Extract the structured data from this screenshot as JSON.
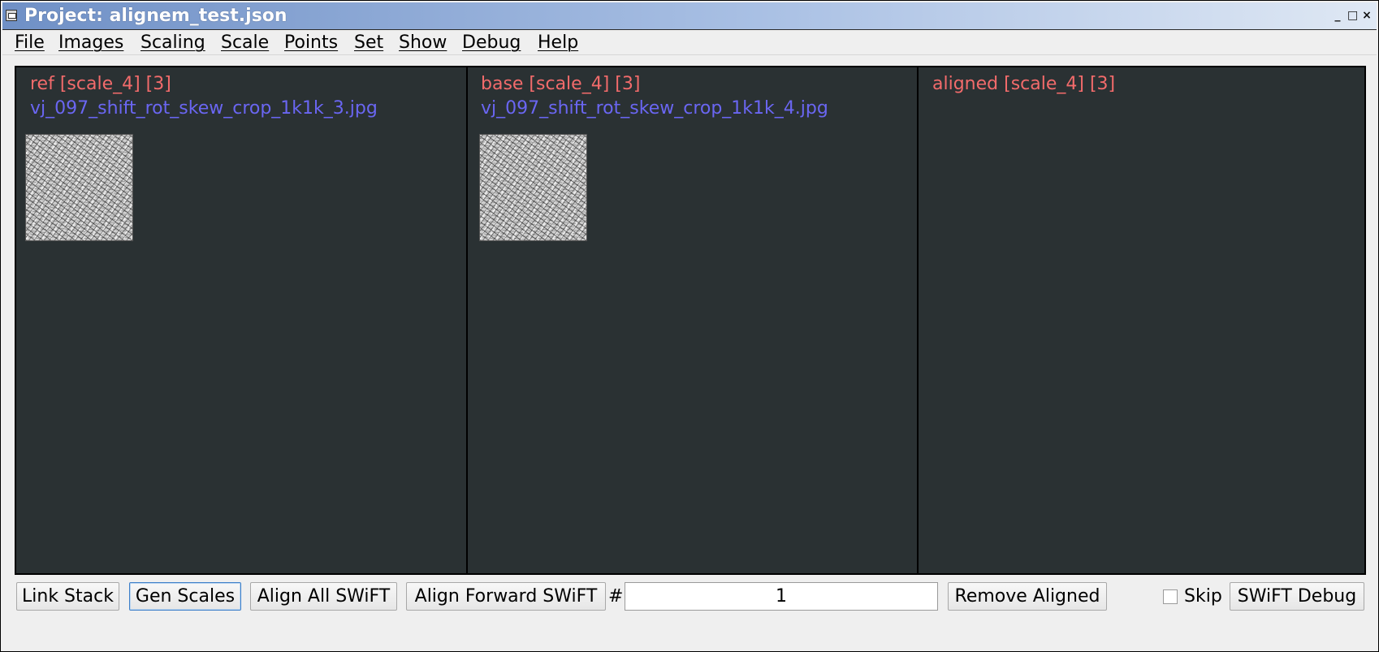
{
  "window": {
    "title": "Project: alignem_test.json",
    "controls": [
      "_",
      "□",
      "×"
    ]
  },
  "menu": [
    "File",
    "Images",
    "Scaling",
    "Scale",
    "Points",
    "Set",
    "Show",
    "Debug",
    "Help"
  ],
  "panels": [
    {
      "label": "ref [scale_4] [3]",
      "file": "vj_097_shift_rot_skew_crop_1k1k_3.jpg"
    },
    {
      "label": "base [scale_4] [3]",
      "file": "vj_097_shift_rot_skew_crop_1k1k_4.jpg"
    },
    {
      "label": "aligned [scale_4] [3]"
    }
  ],
  "toolbar": {
    "link_stack": "Link Stack",
    "gen_scales": "Gen Scales",
    "align_all": "Align All SWiFT",
    "align_forward": "Align Forward SWiFT",
    "hash": "#",
    "count_value": "1",
    "remove_aligned": "Remove Aligned",
    "skip_label": "Skip",
    "skip_checked": false,
    "swift_debug": "SWiFT Debug"
  },
  "colors": {
    "panel_bg": "#2a3133",
    "label_red": "#f26b6b",
    "file_blue": "#6a66f2"
  }
}
